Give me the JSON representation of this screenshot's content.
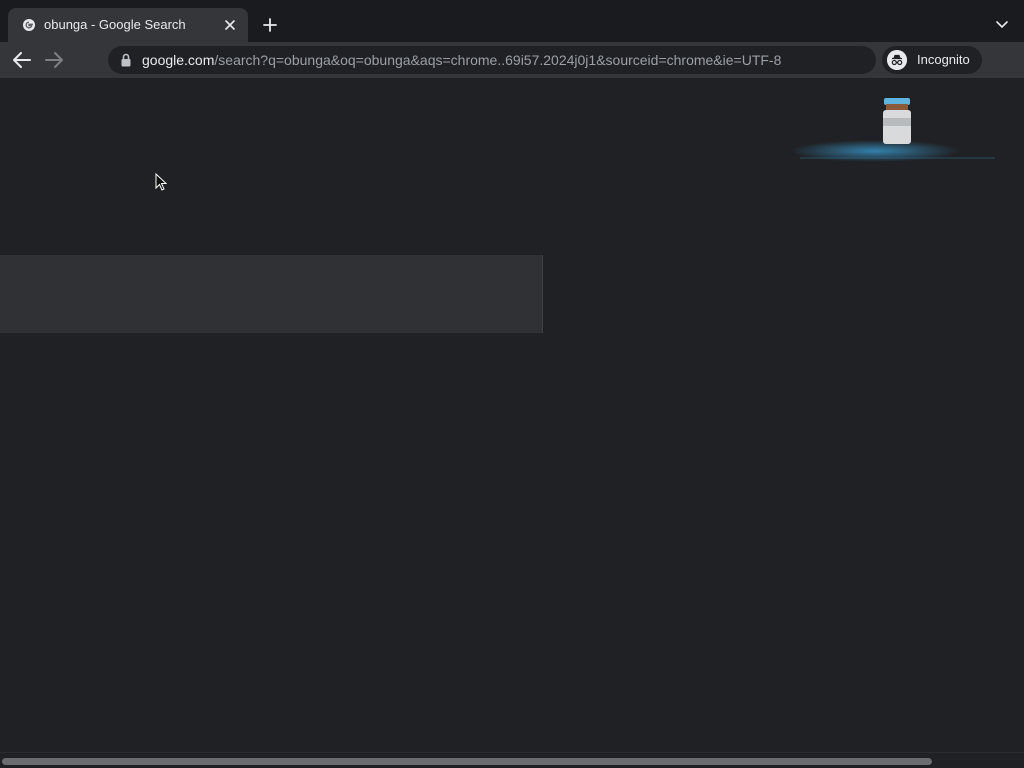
{
  "tab": {
    "title": "obunga - Google Search",
    "favicon": "google-g-icon"
  },
  "toolbar": {
    "url_host": "google.com",
    "url_path": "/search?q=obunga&oq=obunga&aqs=chrome..69i57.2024j0j1&sourceid=chrome&ie=UTF-8",
    "incognito_label": "Incognito"
  },
  "icons": {
    "back": "arrow-left-icon",
    "forward": "arrow-right-icon",
    "close": "close-icon",
    "new_tab": "plus-icon",
    "tab_search": "chevron-down-icon",
    "lock": "lock-icon",
    "incognito": "incognito-icon"
  },
  "colors": {
    "page_background": "#202124",
    "toolbar_background": "#35363a",
    "tabstrip_background": "#1a1b1e",
    "text_primary": "#e8eaed",
    "text_secondary": "#9aa0a6",
    "placeholder_block": "#303134"
  }
}
